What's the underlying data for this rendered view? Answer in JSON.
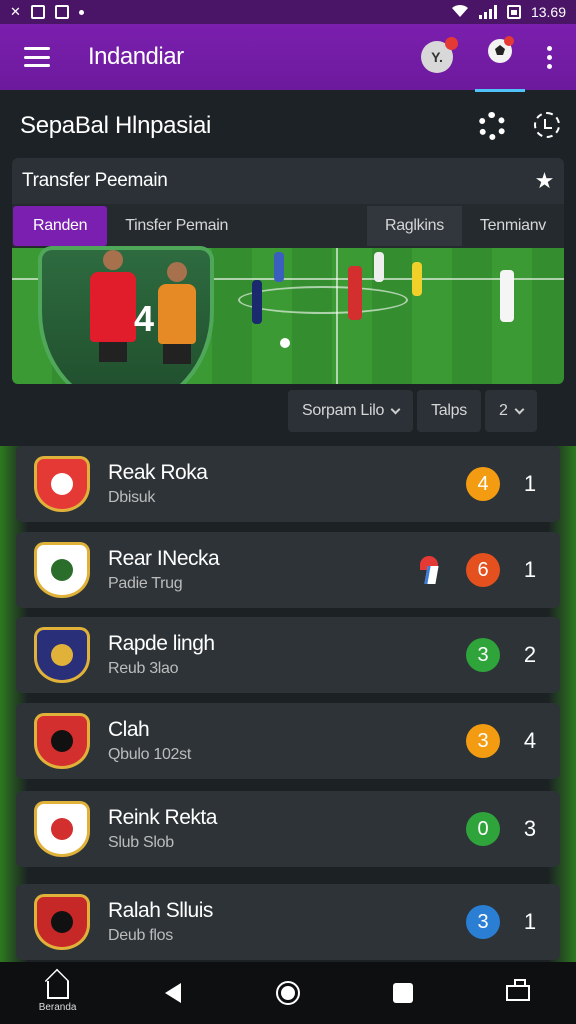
{
  "status_bar": {
    "time": "13.69",
    "left_icons": [
      "notification-icon",
      "sim-icon",
      "image-icon",
      "dot-icon"
    ],
    "right_icons": [
      "wifi-icon",
      "signal-icon",
      "battery-icon"
    ]
  },
  "app_bar": {
    "title": "Indandiar",
    "avatar_glyph": "Y.",
    "icons": [
      "menu-icon",
      "profile-icon",
      "soccer-ball-icon",
      "more-vert-icon"
    ]
  },
  "section": {
    "title": "SepaBal Hlnpasiai",
    "icons": [
      "settings-icon",
      "sync-icon"
    ]
  },
  "transfer_card": {
    "title": "Transfer Peemain",
    "tabs": [
      {
        "label": "Randen",
        "active": true
      },
      {
        "label": "Tinsfer Pemain",
        "active": false
      },
      {
        "label": "Raglkins",
        "active": false
      },
      {
        "label": "Tenmianv",
        "active": false
      }
    ],
    "banner_number": "4"
  },
  "filters": [
    {
      "label": "Sorpam Lilo"
    },
    {
      "label": "Talps"
    },
    {
      "label": "2"
    }
  ],
  "clubs": [
    {
      "name": "Reak Roka",
      "sub": "Dbisuk",
      "score": "4",
      "score_color": "#f39c12",
      "rank": "1",
      "crest_colors": [
        "#e53935",
        "#ffffff"
      ],
      "flag": false
    },
    {
      "name": "Rear INecka",
      "sub": "Padie Trug",
      "score": "6",
      "score_color": "#e5501f",
      "rank": "1",
      "crest_colors": [
        "#ffffff",
        "#2b6e2b"
      ],
      "flag": true
    },
    {
      "name": "Rapde lingh",
      "sub": "Reub 3lao",
      "score": "3",
      "score_color": "#2ea43a",
      "rank": "2",
      "crest_colors": [
        "#2a2f7a",
        "#e0b23a"
      ],
      "flag": false
    },
    {
      "name": "Clah",
      "sub": "Qbulo 102st",
      "score": "3",
      "score_color": "#f39c12",
      "rank": "4",
      "crest_colors": [
        "#d32f2f",
        "#111111"
      ],
      "flag": false
    },
    {
      "name": "Reink Rekta",
      "sub": "Slub Slob",
      "score": "0",
      "score_color": "#2ea43a",
      "rank": "3",
      "crest_colors": [
        "#ffffff",
        "#d32f2f"
      ],
      "flag": false
    },
    {
      "name": "Ralah Slluis",
      "sub": "Deub flos",
      "score": "3",
      "score_color": "#2a7fd4",
      "rank": "1",
      "crest_colors": [
        "#c62828",
        "#111111"
      ],
      "flag": false
    }
  ],
  "bottom_nav": {
    "home_label": "Beranda",
    "icons": [
      "home-icon",
      "back-icon",
      "home-button-icon",
      "recents-icon",
      "tray-icon"
    ]
  }
}
